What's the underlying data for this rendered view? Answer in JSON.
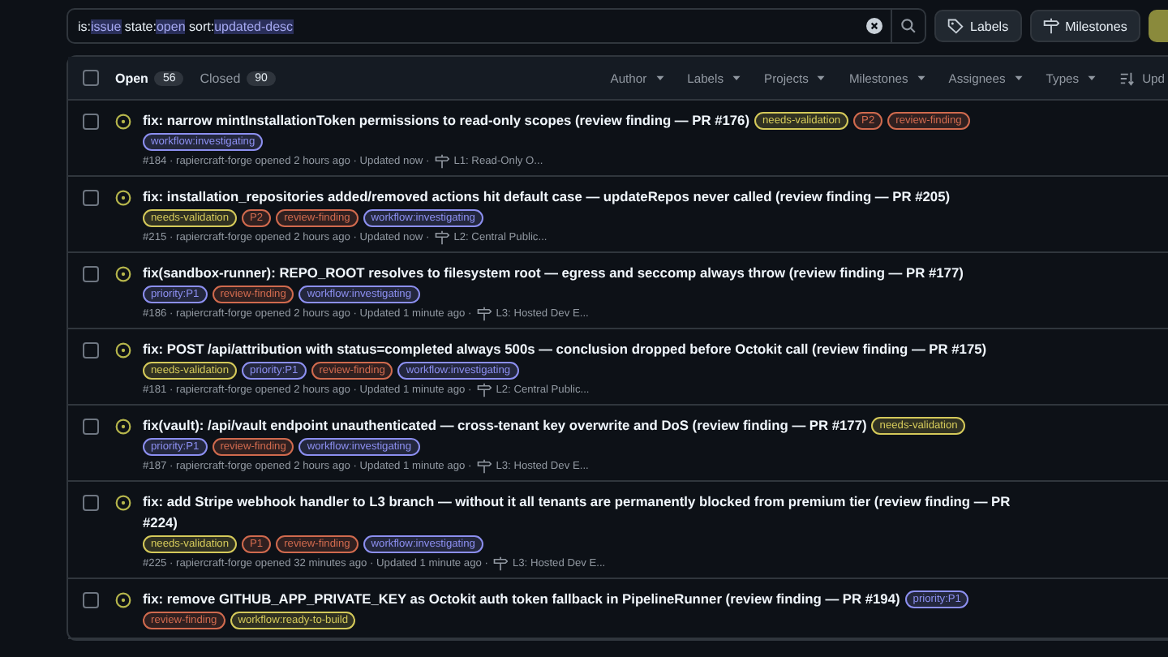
{
  "search": {
    "tokens": [
      {
        "key": "is:",
        "value": "issue"
      },
      {
        "key": "state:",
        "value": "open"
      },
      {
        "key": "sort:",
        "value": "updated-desc"
      }
    ]
  },
  "toolbar_buttons": [
    {
      "label": "Labels",
      "kind": "labels"
    },
    {
      "label": "Milestones",
      "kind": "milestones"
    }
  ],
  "header": {
    "checked": false,
    "states": [
      {
        "label": "Open",
        "count": "56",
        "selected": true
      },
      {
        "label": "Closed",
        "count": "90",
        "selected": false
      }
    ],
    "filters": [
      "Author",
      "Labels",
      "Projects",
      "Milestones",
      "Assignees",
      "Types"
    ],
    "sort": "Upd"
  },
  "issues": [
    {
      "checked": false,
      "title": "fix: narrow mintInstallationToken permissions to read-only scopes (review finding — PR #176)",
      "labels": [
        {
          "name": "needs-validation",
          "color": "#d4c95a"
        },
        {
          "name": "P2",
          "color": "#d06a4e"
        },
        {
          "name": "review-finding",
          "color": "#d06a4e"
        },
        {
          "name": "workflow:investigating",
          "color": "#8c8ff0"
        }
      ],
      "meta": "#184 · rapiercraft-forge opened 2 hours ago · Updated now ·",
      "milestone": "L1: Read-Only O..."
    },
    {
      "checked": false,
      "title": "fix: installation_repositories added/removed actions hit default case — updateRepos never called (review finding — PR #205)",
      "labels": [
        {
          "name": "needs-validation",
          "color": "#d4c95a"
        },
        {
          "name": "P2",
          "color": "#d06a4e"
        },
        {
          "name": "review-finding",
          "color": "#d06a4e"
        },
        {
          "name": "workflow:investigating",
          "color": "#8c8ff0"
        }
      ],
      "meta": "#215 · rapiercraft-forge opened 2 hours ago · Updated now ·",
      "milestone": "L2: Central Public..."
    },
    {
      "checked": false,
      "title": "fix(sandbox-runner): REPO_ROOT resolves to filesystem root — egress and seccomp always throw (review finding — PR #177)",
      "labels": [
        {
          "name": "priority:P1",
          "color": "#8c8ff0"
        },
        {
          "name": "review-finding",
          "color": "#d06a4e"
        },
        {
          "name": "workflow:investigating",
          "color": "#8c8ff0"
        }
      ],
      "meta": "#186 · rapiercraft-forge opened 2 hours ago · Updated 1 minute ago ·",
      "milestone": "L3: Hosted Dev E..."
    },
    {
      "checked": false,
      "title": "fix: POST /api/attribution with status=completed always 500s — conclusion dropped before Octokit call (review finding — PR #175)",
      "labels": [
        {
          "name": "needs-validation",
          "color": "#d4c95a"
        },
        {
          "name": "priority:P1",
          "color": "#8c8ff0"
        },
        {
          "name": "review-finding",
          "color": "#d06a4e"
        },
        {
          "name": "workflow:investigating",
          "color": "#8c8ff0"
        }
      ],
      "meta": "#181 · rapiercraft-forge opened 2 hours ago · Updated 1 minute ago ·",
      "milestone": "L2: Central Public..."
    },
    {
      "checked": false,
      "title": "fix(vault): /api/vault endpoint unauthenticated — cross-tenant key overwrite and DoS (review finding — PR #177)",
      "labels": [
        {
          "name": "needs-validation",
          "color": "#d4c95a"
        },
        {
          "name": "priority:P1",
          "color": "#8c8ff0"
        },
        {
          "name": "review-finding",
          "color": "#d06a4e"
        },
        {
          "name": "workflow:investigating",
          "color": "#8c8ff0"
        }
      ],
      "meta": "#187 · rapiercraft-forge opened 2 hours ago · Updated 1 minute ago ·",
      "milestone": "L3: Hosted Dev E..."
    },
    {
      "checked": false,
      "title": "fix: add Stripe webhook handler to L3 branch — without it all tenants are permanently blocked from premium tier (review finding — PR #224)",
      "labels": [
        {
          "name": "needs-validation",
          "color": "#d4c95a"
        },
        {
          "name": "P1",
          "color": "#d06a4e"
        },
        {
          "name": "review-finding",
          "color": "#d06a4e"
        },
        {
          "name": "workflow:investigating",
          "color": "#8c8ff0"
        }
      ],
      "meta": "#225 · rapiercraft-forge opened 32 minutes ago · Updated 1 minute ago ·",
      "milestone": "L3: Hosted Dev E..."
    },
    {
      "checked": false,
      "title": "fix: remove GITHUB_APP_PRIVATE_KEY as Octokit auth token fallback in PipelineRunner (review finding — PR #194)",
      "labels": [
        {
          "name": "priority:P1",
          "color": "#8c8ff0"
        },
        {
          "name": "review-finding",
          "color": "#d06a4e"
        },
        {
          "name": "workflow:ready-to-build",
          "color": "#d4c95a"
        }
      ]
    }
  ]
}
